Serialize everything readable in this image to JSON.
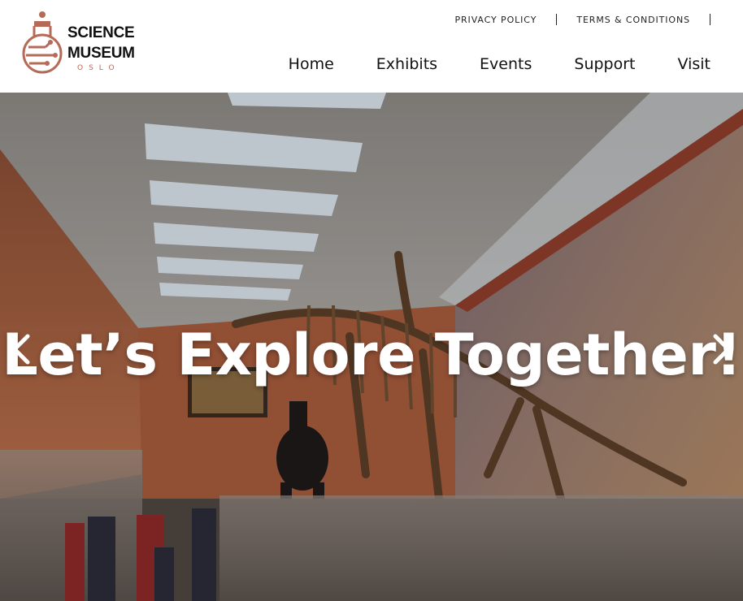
{
  "brand": {
    "name_line1": "SCIENCE",
    "name_line2": "MUSEUM",
    "city": "OSLO",
    "logo_color": "#b66a58"
  },
  "utility_nav": {
    "privacy": "PRIVACY POLICY",
    "terms": "TERMS & CONDITIONS"
  },
  "main_nav": [
    "Home",
    "Exhibits",
    "Events",
    "Support",
    "Visit"
  ],
  "hero": {
    "title": "Let’s Explore Together!",
    "prev_icon": "chevron-left-icon",
    "next_icon": "chevron-right-icon",
    "image_subject": "dinosaur-skeleton-hall-photo"
  }
}
